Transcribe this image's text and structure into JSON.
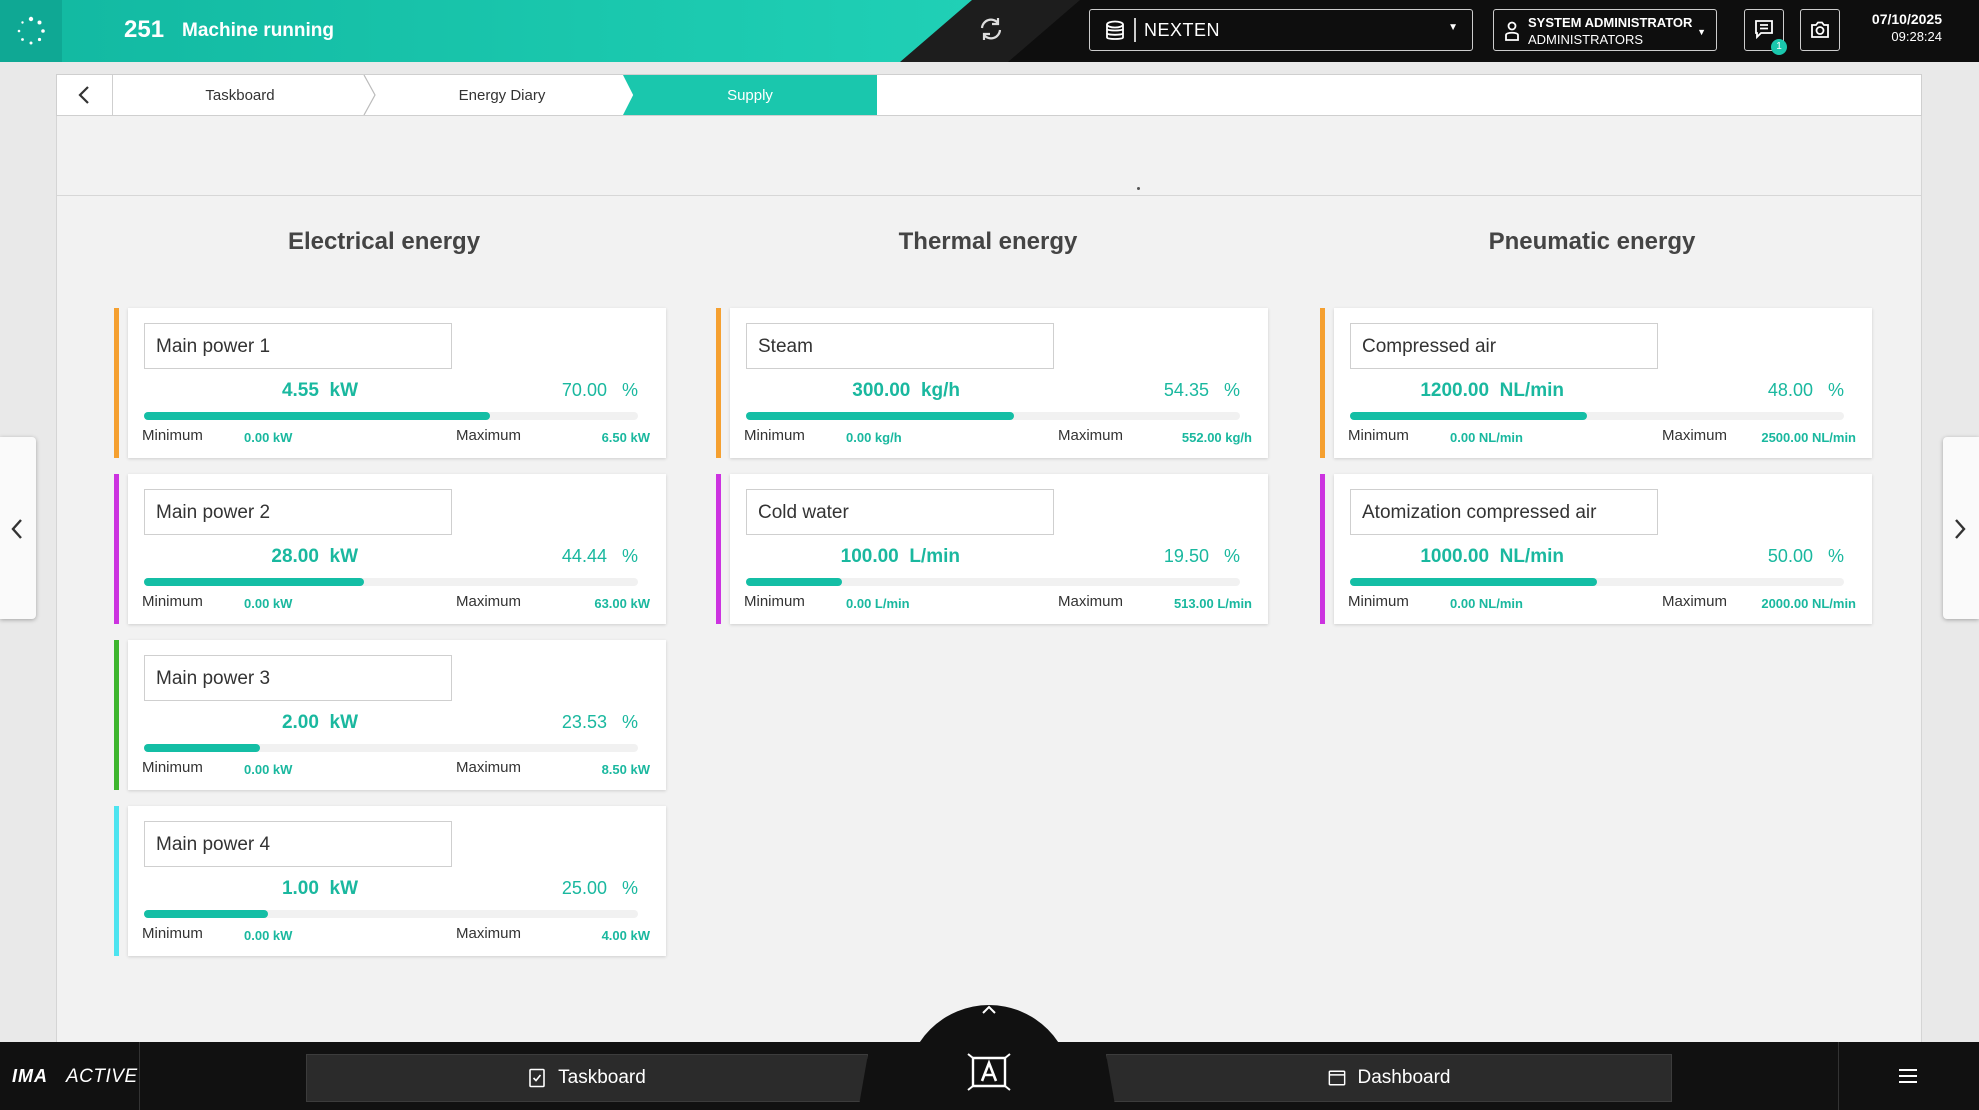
{
  "header": {
    "machine_number": "251",
    "machine_status": "Machine running",
    "database": "NEXTEN",
    "user_name": "SYSTEM ADMINISTRATOR",
    "user_group": "ADMINISTRATORS",
    "notification_count": "1",
    "date": "07/10/2025",
    "time": "09:28:24"
  },
  "breadcrumb": {
    "items": [
      "Taskboard",
      "Energy Diary",
      "Supply"
    ]
  },
  "columns": [
    {
      "title": "Electrical energy",
      "cards": [
        {
          "name": "Main power 1",
          "value": "4.55",
          "unit": "kW",
          "percent": "70.00",
          "percent_unit": "%",
          "min_label": "Minimum",
          "min": "0.00 kW",
          "max_label": "Maximum",
          "max": "6.50 kW",
          "fill": 0.7,
          "accent": "#f5a030"
        },
        {
          "name": "Main power 2",
          "value": "28.00",
          "unit": "kW",
          "percent": "44.44",
          "percent_unit": "%",
          "min_label": "Minimum",
          "min": "0.00 kW",
          "max_label": "Maximum",
          "max": "63.00 kW",
          "fill": 0.4444,
          "accent": "#cc33e0"
        },
        {
          "name": "Main power 3",
          "value": "2.00",
          "unit": "kW",
          "percent": "23.53",
          "percent_unit": "%",
          "min_label": "Minimum",
          "min": "0.00 kW",
          "max_label": "Maximum",
          "max": "8.50 kW",
          "fill": 0.2353,
          "accent": "#3db52d"
        },
        {
          "name": "Main power 4",
          "value": "1.00",
          "unit": "kW",
          "percent": "25.00",
          "percent_unit": "%",
          "min_label": "Minimum",
          "min": "0.00 kW",
          "max_label": "Maximum",
          "max": "4.00 kW",
          "fill": 0.25,
          "accent": "#4de4f0"
        }
      ]
    },
    {
      "title": "Thermal energy",
      "cards": [
        {
          "name": "Steam",
          "value": "300.00",
          "unit": "kg/h",
          "percent": "54.35",
          "percent_unit": "%",
          "min_label": "Minimum",
          "min": "0.00 kg/h",
          "max_label": "Maximum",
          "max": "552.00 kg/h",
          "fill": 0.5435,
          "accent": "#f5a030"
        },
        {
          "name": "Cold water",
          "value": "100.00",
          "unit": "L/min",
          "percent": "19.50",
          "percent_unit": "%",
          "min_label": "Minimum",
          "min": "0.00 L/min",
          "max_label": "Maximum",
          "max": "513.00 L/min",
          "fill": 0.195,
          "accent": "#cc33e0"
        }
      ]
    },
    {
      "title": "Pneumatic energy",
      "cards": [
        {
          "name": "Compressed air",
          "value": "1200.00",
          "unit": "NL/min",
          "percent": "48.00",
          "percent_unit": "%",
          "min_label": "Minimum",
          "min": "0.00 NL/min",
          "max_label": "Maximum",
          "max": "2500.00 NL/min",
          "fill": 0.48,
          "accent": "#f5a030"
        },
        {
          "name": "Atomization compressed air",
          "value": "1000.00",
          "unit": "NL/min",
          "percent": "50.00",
          "percent_unit": "%",
          "min_label": "Minimum",
          "min": "0.00 NL/min",
          "max_label": "Maximum",
          "max": "2000.00 NL/min",
          "fill": 0.5,
          "accent": "#cc33e0"
        }
      ]
    }
  ],
  "footer": {
    "logo_ima": "IMA",
    "logo_active": "ACTIVE",
    "taskboard_label": "Taskboard",
    "dashboard_label": "Dashboard"
  },
  "colors": {
    "accent": "#1ac7ad",
    "top_bar": "#0e0e0e",
    "bottom_bar": "#111111"
  },
  "icons": [
    "spinner-icon",
    "sync-icon",
    "database-icon",
    "user-icon",
    "message-icon",
    "camera-icon",
    "back-chevron-icon",
    "left-arrow-icon",
    "right-arrow-icon",
    "taskboard-icon",
    "dashboard-icon",
    "hmi-center-icon",
    "caret-up-icon",
    "menu-icon"
  ]
}
